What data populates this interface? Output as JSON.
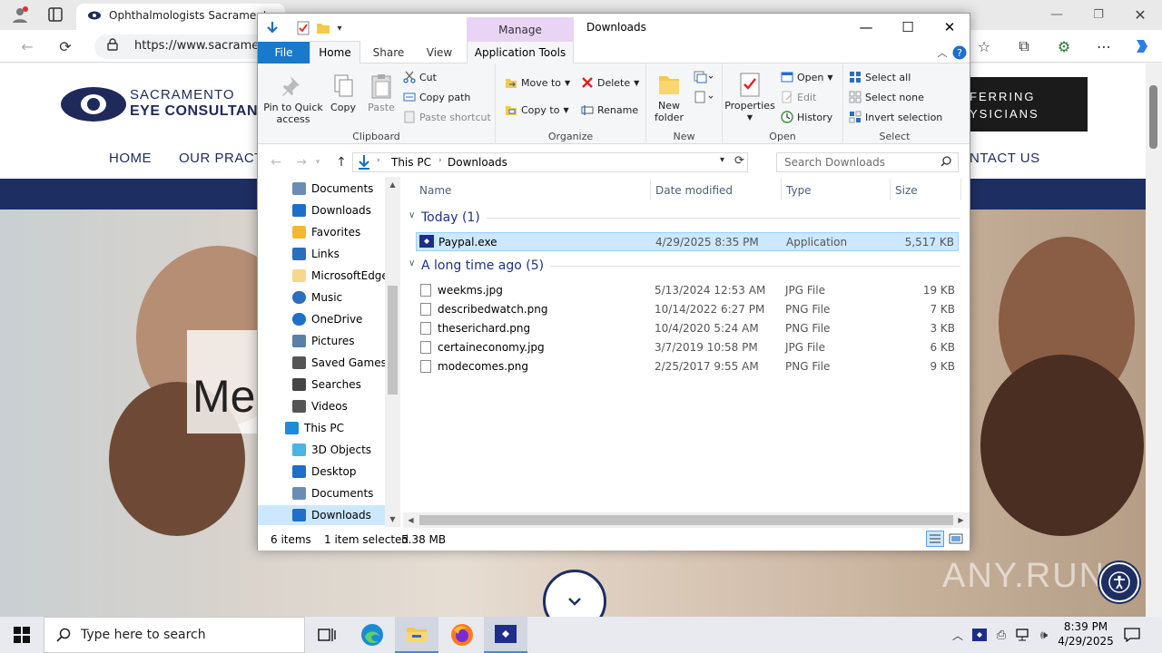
{
  "browser": {
    "tab_title": "Ophthalmologists Sacramento",
    "url": "https://www.sacramen"
  },
  "site": {
    "logo_line1": "SACRAMENTO",
    "logo_line2": "EYE CONSULTANT",
    "nav": [
      "HOME",
      "OUR PRACT",
      "NTACT US"
    ],
    "refer_line1": "FERRING",
    "refer_line2": "YSICIANS",
    "hero_text": "Me",
    "watermark": "ANY.RUN"
  },
  "explorer": {
    "title": "Downloads",
    "manage_label": "Manage",
    "tabs": {
      "file": "File",
      "home": "Home",
      "share": "Share",
      "view": "View",
      "app_tools": "Application Tools"
    },
    "ribbon": {
      "clipboard": {
        "label": "Clipboard",
        "pin": "Pin to Quick access",
        "copy": "Copy",
        "paste": "Paste",
        "cut": "Cut",
        "copy_path": "Copy path",
        "paste_shortcut": "Paste shortcut"
      },
      "organize": {
        "label": "Organize",
        "move_to": "Move to",
        "copy_to": "Copy to",
        "delete": "Delete",
        "rename": "Rename"
      },
      "new": {
        "label": "New",
        "new_folder": "New folder"
      },
      "open": {
        "label": "Open",
        "properties": "Properties",
        "open": "Open",
        "edit": "Edit",
        "history": "History"
      },
      "select": {
        "label": "Select",
        "select_all": "Select all",
        "select_none": "Select none",
        "invert": "Invert selection"
      }
    },
    "breadcrumb": [
      "This PC",
      "Downloads"
    ],
    "search_placeholder": "Search Downloads",
    "nav_items": [
      {
        "label": "Documents",
        "icon": "document-icon"
      },
      {
        "label": "Downloads",
        "icon": "download-icon"
      },
      {
        "label": "Favorites",
        "icon": "star-icon"
      },
      {
        "label": "Links",
        "icon": "link-icon"
      },
      {
        "label": "MicrosoftEdge",
        "icon": "folder-icon"
      },
      {
        "label": "Music",
        "icon": "music-icon"
      },
      {
        "label": "OneDrive",
        "icon": "cloud-icon"
      },
      {
        "label": "Pictures",
        "icon": "pictures-icon"
      },
      {
        "label": "Saved Games",
        "icon": "games-icon"
      },
      {
        "label": "Searches",
        "icon": "search-icon"
      },
      {
        "label": "Videos",
        "icon": "video-icon"
      },
      {
        "label": "This PC",
        "icon": "computer-icon"
      },
      {
        "label": "3D Objects",
        "icon": "cube-icon"
      },
      {
        "label": "Desktop",
        "icon": "desktop-icon"
      },
      {
        "label": "Documents",
        "icon": "document-icon"
      },
      {
        "label": "Downloads",
        "icon": "download-icon"
      }
    ],
    "columns": {
      "name": "Name",
      "date": "Date modified",
      "type": "Type",
      "size": "Size"
    },
    "groups": [
      {
        "label": "Today (1)",
        "files": [
          {
            "name": "Paypal.exe",
            "date": "4/29/2025 8:35 PM",
            "type": "Application",
            "size": "5,517 KB",
            "selected": true
          }
        ]
      },
      {
        "label": "A long time ago (5)",
        "files": [
          {
            "name": "weekms.jpg",
            "date": "5/13/2024 12:53 AM",
            "type": "JPG File",
            "size": "19 KB"
          },
          {
            "name": "describedwatch.png",
            "date": "10/14/2022 6:27 PM",
            "type": "PNG File",
            "size": "7 KB"
          },
          {
            "name": "theserichard.png",
            "date": "10/4/2020 5:24 AM",
            "type": "PNG File",
            "size": "3 KB"
          },
          {
            "name": "certaineconomy.jpg",
            "date": "3/7/2019 10:58 PM",
            "type": "JPG File",
            "size": "6 KB"
          },
          {
            "name": "modecomes.png",
            "date": "2/25/2017 9:55 AM",
            "type": "PNG File",
            "size": "9 KB"
          }
        ]
      }
    ],
    "status": {
      "items": "6 items",
      "selected": "1 item selected",
      "size": "5.38 MB"
    }
  },
  "taskbar": {
    "search_placeholder": "Type here to search",
    "time": "8:39 PM",
    "date": "4/29/2025"
  }
}
